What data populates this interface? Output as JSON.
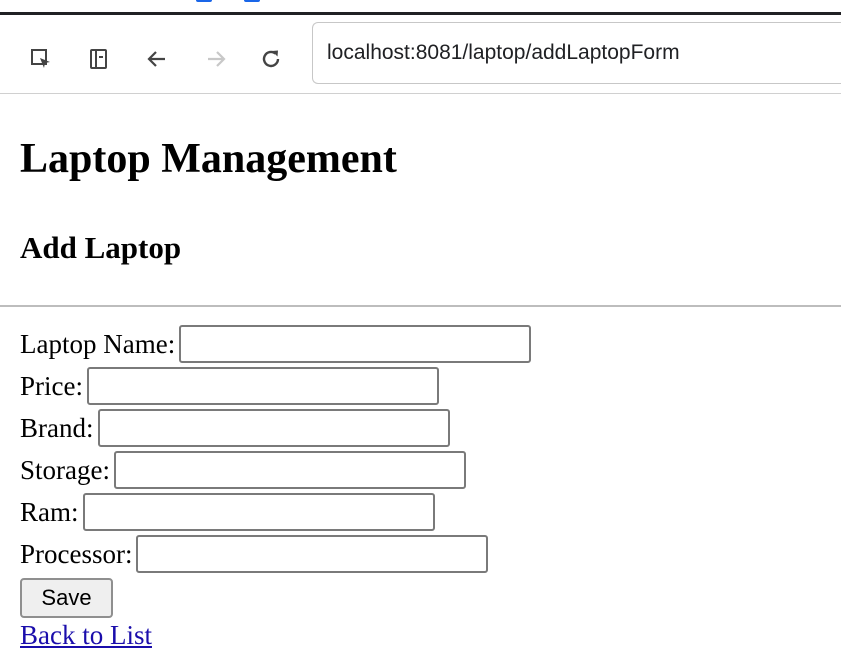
{
  "browser": {
    "url": "localhost:8081/laptop/addLaptopForm",
    "icons": [
      "inspect-element-icon",
      "device-toolbar-icon",
      "back-arrow-icon",
      "forward-arrow-icon",
      "reload-icon"
    ]
  },
  "page": {
    "title": "Laptop Management",
    "subtitle": "Add Laptop",
    "form": {
      "fields": [
        {
          "label": "Laptop Name:",
          "value": ""
        },
        {
          "label": "Price:",
          "value": ""
        },
        {
          "label": "Brand:",
          "value": ""
        },
        {
          "label": "Storage:",
          "value": ""
        },
        {
          "label": "Ram:",
          "value": ""
        },
        {
          "label": "Processor:",
          "value": ""
        }
      ],
      "save_label": "Save"
    },
    "back_link": "Back to List"
  },
  "colors": {
    "link": "#1a0dab",
    "accent": "#1a66e8"
  }
}
